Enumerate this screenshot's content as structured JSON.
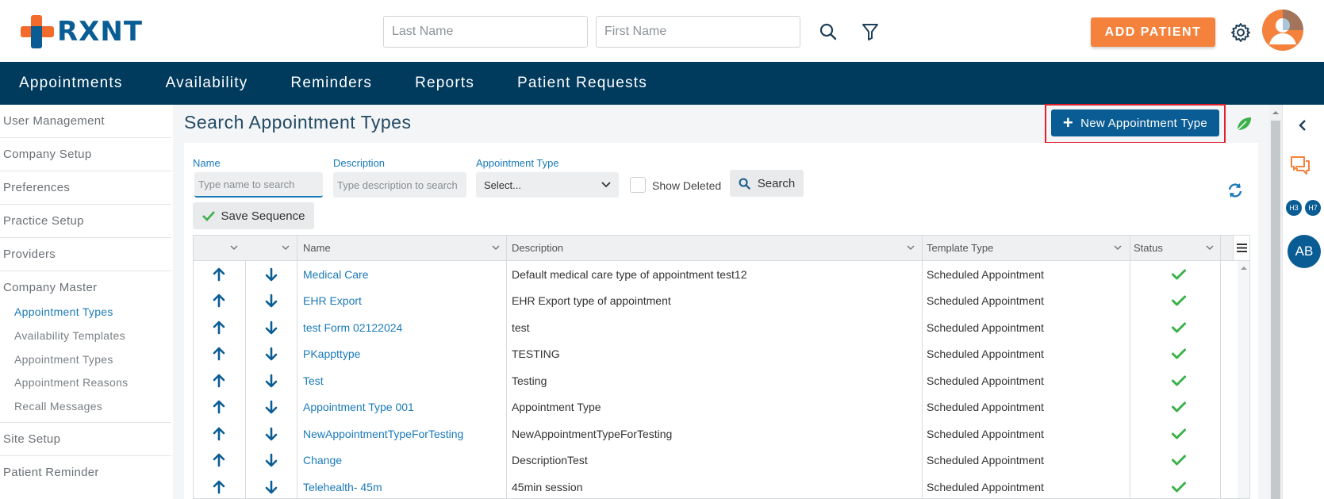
{
  "header": {
    "logo_text": "RXNT",
    "last_name_placeholder": "Last Name",
    "first_name_placeholder": "First Name",
    "add_patient_label": "ADD PATIENT"
  },
  "nav": {
    "items": [
      "Appointments",
      "Availability",
      "Reminders",
      "Reports",
      "Patient Requests"
    ]
  },
  "sidebar": {
    "items": [
      "User Management",
      "Company Setup",
      "Preferences",
      "Practice Setup",
      "Providers",
      "Company Master"
    ],
    "sub_items": [
      "Appointment Types",
      "Availability Templates",
      "Appointment Types",
      "Appointment Reasons",
      "Recall Messages"
    ],
    "bottom_items": [
      "Site Setup",
      "Patient Reminder"
    ]
  },
  "page": {
    "title": "Search Appointment Types",
    "new_button_label": "New Appointment Type"
  },
  "filters": {
    "name_label": "Name",
    "name_placeholder": "Type name to search",
    "description_label": "Description",
    "description_placeholder": "Type description to search",
    "type_label": "Appointment Type",
    "type_value": "Select...",
    "show_deleted_label": "Show Deleted",
    "search_label": "Search",
    "save_sequence_label": "Save Sequence"
  },
  "table": {
    "columns": [
      "Name",
      "Description",
      "Template Type",
      "Status"
    ],
    "rows": [
      {
        "name": "Medical Care",
        "description": "Default medical care type of appointment test12",
        "template": "Scheduled Appointment"
      },
      {
        "name": "EHR Export",
        "description": "EHR Export type of appointment",
        "template": "Scheduled Appointment"
      },
      {
        "name": "test Form 02122024",
        "description": "test",
        "template": "Scheduled Appointment"
      },
      {
        "name": "PKappttype",
        "description": "TESTING",
        "template": "Scheduled Appointment"
      },
      {
        "name": "Test",
        "description": "Testing",
        "template": "Scheduled Appointment"
      },
      {
        "name": "Appointment Type 001",
        "description": "Appointment Type",
        "template": "Scheduled Appointment"
      },
      {
        "name": "NewAppointmentTypeForTesting",
        "description": "NewAppointmentTypeForTesting",
        "template": "Scheduled Appointment"
      },
      {
        "name": "Change",
        "description": "DescriptionTest",
        "template": "Scheduled Appointment"
      },
      {
        "name": "Telehealth- 45m",
        "description": "45min session",
        "template": "Scheduled Appointment"
      }
    ]
  },
  "right_rail": {
    "badge_1": "H3",
    "badge_2": "H7",
    "avatar_initials": "AB"
  },
  "colors": {
    "brand_blue": "#0a5d94",
    "nav_bg": "#003a5d",
    "accent_orange": "#f5823c",
    "link": "#1a7ab8",
    "status_green": "#3cb04a",
    "highlight_red": "#e0202a"
  }
}
